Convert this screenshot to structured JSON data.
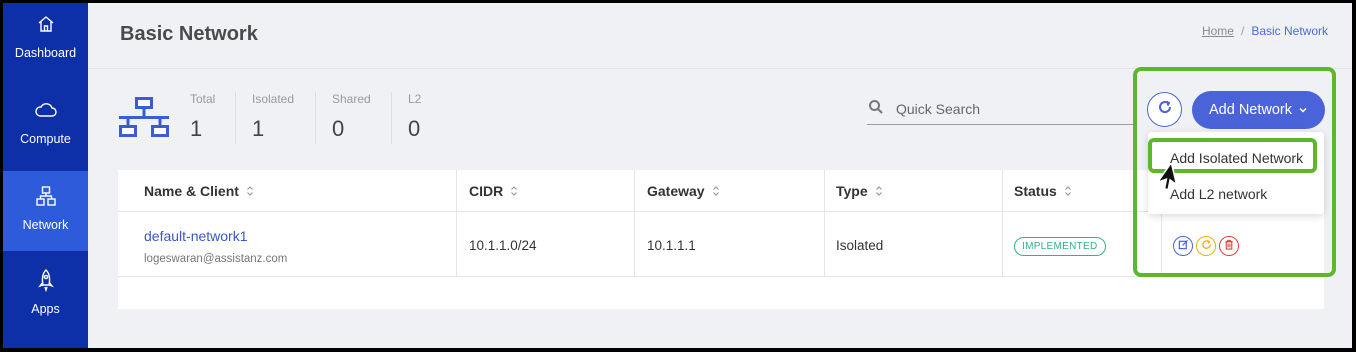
{
  "sidebar": {
    "items": [
      {
        "label": "Dashboard",
        "icon": "home-icon"
      },
      {
        "label": "Compute",
        "icon": "cloud-icon"
      },
      {
        "label": "Network",
        "icon": "network-icon",
        "active": true
      },
      {
        "label": "Apps",
        "icon": "rocket-icon"
      }
    ]
  },
  "header": {
    "title": "Basic Network",
    "breadcrumb": {
      "home": "Home",
      "separator": "/",
      "current": "Basic Network"
    }
  },
  "stats": [
    {
      "label": "Total",
      "value": "1"
    },
    {
      "label": "Isolated",
      "value": "1"
    },
    {
      "label": "Shared",
      "value": "0"
    },
    {
      "label": "L2",
      "value": "0"
    }
  ],
  "search": {
    "placeholder": "Quick Search",
    "value": ""
  },
  "toolbar": {
    "add_label": "Add Network"
  },
  "dropdown": {
    "items": [
      "Add Isolated Network",
      "Add L2 network"
    ],
    "highlighted": "Add Isolated Network"
  },
  "table": {
    "columns": [
      "Name & Client",
      "CIDR",
      "Gateway",
      "Type",
      "Status"
    ],
    "rows": [
      {
        "name": "default-network1",
        "client": "logeswaran@assistanz.com",
        "cidr": "10.1.1.0/24",
        "gateway": "10.1.1.1",
        "type": "Isolated",
        "status": "IMPLEMENTED"
      }
    ]
  },
  "colors": {
    "sidebar_bg": "#0d2fa8",
    "sidebar_active": "#2e5bd9",
    "accent": "#4a63d8",
    "status_green": "#2cb585",
    "highlight": "#5cb82a"
  }
}
